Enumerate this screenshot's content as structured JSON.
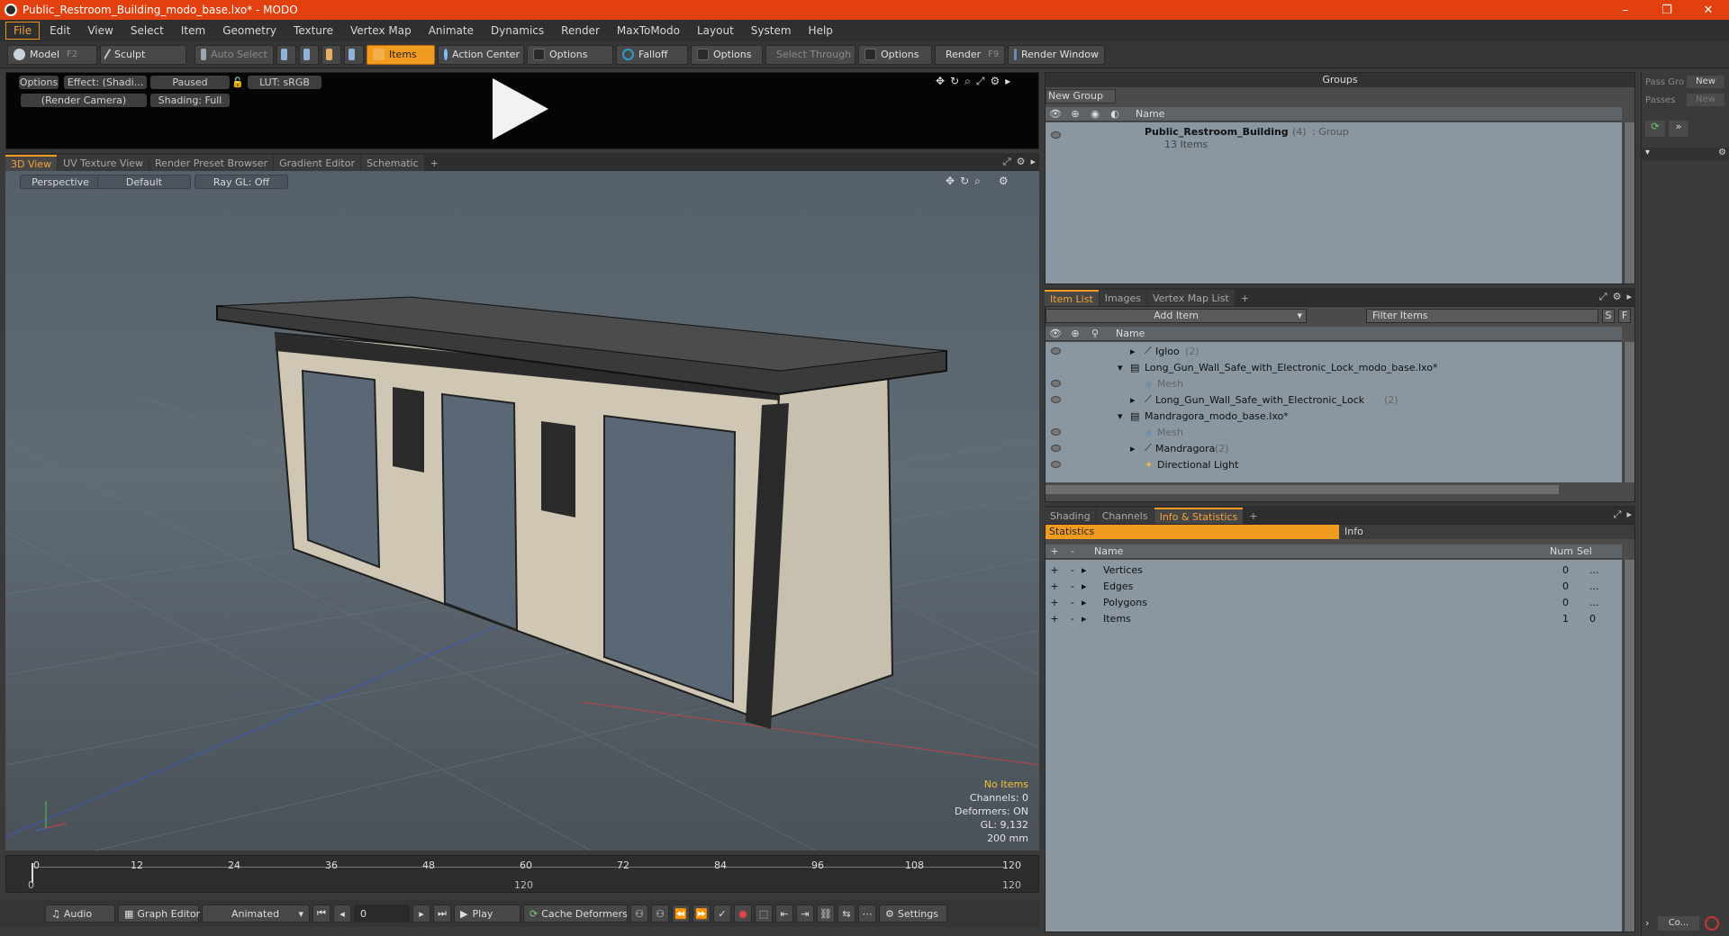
{
  "window": {
    "title": "Public_Restroom_Building_modo_base.lxo* - MODO",
    "min": "–",
    "max": "❐",
    "close": "✕"
  },
  "menu": [
    "File",
    "Edit",
    "View",
    "Select",
    "Item",
    "Geometry",
    "Texture",
    "Vertex Map",
    "Animate",
    "Dynamics",
    "Render",
    "MaxToModo",
    "Layout",
    "System",
    "Help"
  ],
  "toolbar": {
    "model": "Model",
    "model_key": "F2",
    "sculpt": "Sculpt",
    "auto_select": "Auto Select",
    "items": "Items",
    "action_center": "Action Center",
    "options1": "Options",
    "falloff": "Falloff",
    "options2": "Options",
    "select_through": "Select Through",
    "options3": "Options",
    "render": "Render",
    "render_key": "F9",
    "render_window": "Render Window"
  },
  "preview": {
    "options": "Options",
    "effect": "Effect: (Shadi...",
    "paused": "Paused",
    "lut": "LUT: sRGB",
    "camera": "(Render Camera)",
    "shading": "Shading: Full"
  },
  "view_tabs": [
    "3D View",
    "UV Texture View",
    "Render Preset Browser",
    "Gradient Editor",
    "Schematic",
    "+"
  ],
  "viewport": {
    "perspective": "Perspective",
    "default": "Default",
    "raygl": "Ray GL: Off",
    "stats": {
      "no_items": "No Items",
      "channels": "Channels: 0",
      "deformers": "Deformers: ON",
      "gl": "GL: 9,132",
      "mm": "200 mm"
    }
  },
  "timeline": {
    "ticks": [
      "0",
      "12",
      "24",
      "36",
      "48",
      "60",
      "72",
      "84",
      "96",
      "108",
      "120"
    ],
    "start": "0",
    "mid": "120",
    "end": "120"
  },
  "transport": {
    "audio": "Audio",
    "graph_editor": "Graph Editor",
    "animated": "Animated",
    "frame": "0",
    "play": "Play",
    "cache": "Cache Deformers",
    "settings": "Settings"
  },
  "groups": {
    "title": "Groups",
    "new_group": "New Group",
    "name_col": "Name",
    "item_name": "Public_Restroom_Building",
    "item_count": "(4)",
    "item_type": ": Group",
    "item_sub": "13 Items"
  },
  "passes": {
    "pass_label": "Pass Gro",
    "new1": "New",
    "passes_label": "Passes",
    "new2": "New"
  },
  "item_tabs": [
    "Item List",
    "Images",
    "Vertex Map List",
    "+"
  ],
  "itemlist": {
    "add_item": "Add Item",
    "filter": "Filter Items",
    "s": "S",
    "f": "F",
    "name_col": "Name",
    "rows": [
      {
        "name": "Igloo",
        "count": "(2)"
      },
      {
        "name": "Long_Gun_Wall_Safe_with_Electronic_Lock_modo_base.lxo*",
        "count": ""
      },
      {
        "name": "Mesh",
        "count": ""
      },
      {
        "name": "Long_Gun_Wall_Safe_with_Electronic_Lock",
        "count": "(2)"
      },
      {
        "name": "Mandragora_modo_base.lxo*",
        "count": ""
      },
      {
        "name": "Mesh",
        "count": ""
      },
      {
        "name": "Mandragora",
        "count": "(2)"
      },
      {
        "name": "Directional Light",
        "count": ""
      }
    ]
  },
  "stat_tabs": [
    "Shading",
    "Channels",
    "Info & Statistics",
    "+"
  ],
  "statistics": {
    "statistics": "Statistics",
    "info": "Info",
    "name_col": "Name",
    "num_col": "Num",
    "sel_col": "Sel",
    "rows": [
      {
        "name": "Vertices",
        "num": "0",
        "sel": "..."
      },
      {
        "name": "Edges",
        "num": "0",
        "sel": "..."
      },
      {
        "name": "Polygons",
        "num": "0",
        "sel": "..."
      },
      {
        "name": "Items",
        "num": "1",
        "sel": "0"
      }
    ]
  },
  "bottom_right": {
    "co": "Co..."
  }
}
